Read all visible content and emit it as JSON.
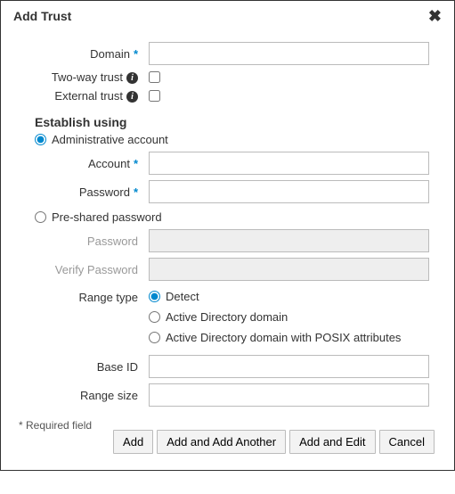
{
  "dialog": {
    "title": "Add Trust"
  },
  "fields": {
    "domain": {
      "label": "Domain",
      "required": true,
      "value": ""
    },
    "two_way": {
      "label": "Two-way trust",
      "checked": false
    },
    "external": {
      "label": "External trust",
      "checked": false
    }
  },
  "establish": {
    "heading": "Establish using",
    "admin": {
      "label": "Administrative account"
    },
    "preshared": {
      "label": "Pre-shared password"
    },
    "account": {
      "label": "Account",
      "required": true,
      "value": ""
    },
    "account_password": {
      "label": "Password",
      "required": true,
      "value": ""
    },
    "psk_password": {
      "label": "Password",
      "value": ""
    },
    "psk_verify": {
      "label": "Verify Password",
      "value": ""
    }
  },
  "range": {
    "type_label": "Range type",
    "options": {
      "detect": "Detect",
      "ad_domain": "Active Directory domain",
      "ad_posix": "Active Directory domain with POSIX attributes"
    },
    "base_id": {
      "label": "Base ID",
      "value": ""
    },
    "range_size": {
      "label": "Range size",
      "value": ""
    }
  },
  "footer": {
    "required_note": "* Required field",
    "add": "Add",
    "add_another": "Add and Add Another",
    "add_edit": "Add and Edit",
    "cancel": "Cancel"
  }
}
